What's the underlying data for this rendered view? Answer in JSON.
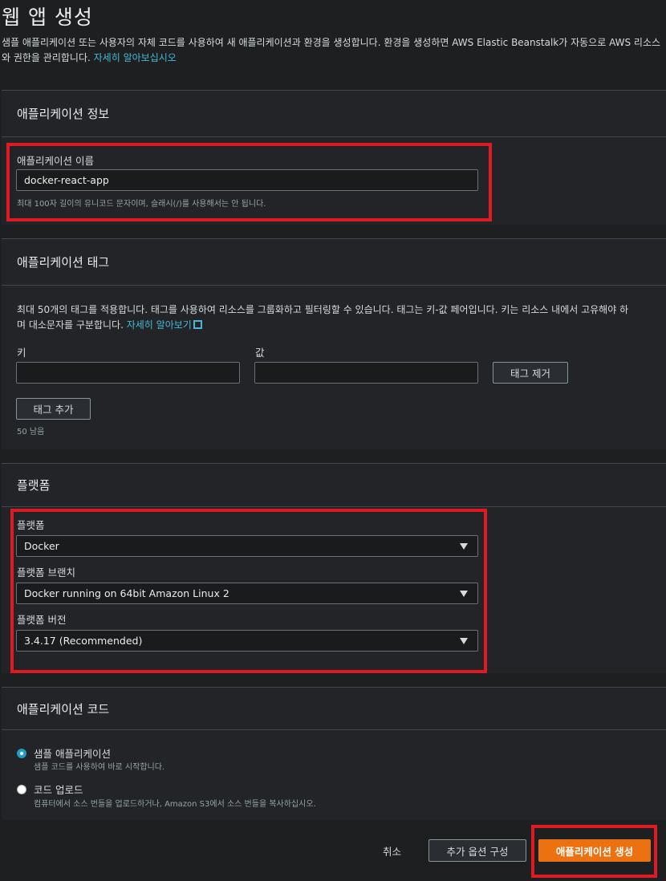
{
  "page": {
    "title": "웹 앱 생성",
    "description": "샘플 애플리케이션 또는 사용자의 자체 코드를 사용하여 새 애플리케이션과 환경을 생성합니다. 환경을 생성하면 AWS Elastic Beanstalk가 자동으로 AWS 리소스와 권한을 관리합니다.",
    "learn_more": "자세히 알아보십시오"
  },
  "app_info": {
    "heading": "애플리케이션 정보",
    "name_label": "애플리케이션 이름",
    "name_value": "docker-react-app",
    "name_hint": "최대 100자 길이의 유니코드 문자이며, 슬래시(/)를 사용해서는 안 됩니다."
  },
  "tags": {
    "heading": "애플리케이션 태그",
    "description": "최대 50개의 태그를 적용합니다. 태그를 사용하여 리소스를 그룹화하고 필터링할 수 있습니다. 태그는 키-값 페어입니다. 키는 리소스 내에서 고유해야 하며 대소문자를 구분합니다.",
    "learn_more": "자세히 알아보기",
    "key_label": "키",
    "value_label": "값",
    "key_value": "",
    "value_value": "",
    "remove_button": "태그 제거",
    "add_button": "태그 추가",
    "remaining": "50 남음"
  },
  "platform": {
    "heading": "플랫폼",
    "platform_label": "플랫폼",
    "platform_value": "Docker",
    "branch_label": "플랫폼 브랜치",
    "branch_value": "Docker running on 64bit Amazon Linux 2",
    "version_label": "플랫폼 버전",
    "version_value": "3.4.17 (Recommended)"
  },
  "app_code": {
    "heading": "애플리케이션 코드",
    "options": [
      {
        "label": "샘플 애플리케이션",
        "hint": "샘플 코드를 사용하여 바로 시작합니다.",
        "selected": true
      },
      {
        "label": "코드 업로드",
        "hint": "컴퓨터에서 소스 번들을 업로드하거나, Amazon S3에서 소스 번들을 복사하십시오.",
        "selected": false
      }
    ]
  },
  "footer": {
    "cancel": "취소",
    "more_options": "추가 옵션 구성",
    "create": "애플리케이션 생성"
  },
  "colors": {
    "accent": "#ec7211",
    "highlight": "#e01a22",
    "link": "#44b9d6"
  }
}
